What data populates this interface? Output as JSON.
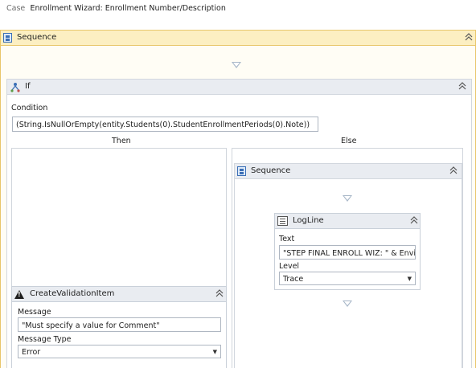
{
  "breadcrumb": {
    "kind": "Case",
    "title": "Enrollment Wizard: Enrollment Number/Description"
  },
  "outer_sequence": {
    "title": "Sequence",
    "icon": "sequence-icon",
    "collapse_icon": "double-chevron-up-icon"
  },
  "if_activity": {
    "title": "If",
    "icon": "if-branch-icon",
    "condition_label": "Condition",
    "condition_value": "(String.IsNullOrEmpty(entity.Students(0).StudentEnrollmentPeriods(0).Note))",
    "then_label": "Then",
    "else_label": "Else"
  },
  "create_validation_item": {
    "title": "CreateValidationItem",
    "icon": "warning-icon",
    "message_label": "Message",
    "message_value": "\"Must specify a value for Comment\"",
    "message_type_label": "Message Type",
    "message_type_value": "Error"
  },
  "inner_sequence": {
    "title": "Sequence",
    "icon": "sequence-icon"
  },
  "logline": {
    "title": "LogLine",
    "icon": "log-icon",
    "text_label": "Text",
    "text_value": "\"STEP FINAL ENROLL WIZ: \" & Envir",
    "level_label": "Level",
    "level_value": "Trace"
  },
  "colors": {
    "sequence_header": "#fcefc2",
    "sequence_border": "#e8c66a",
    "activity_header": "#e9ecf1",
    "drop_target": "#a8b7c8"
  }
}
